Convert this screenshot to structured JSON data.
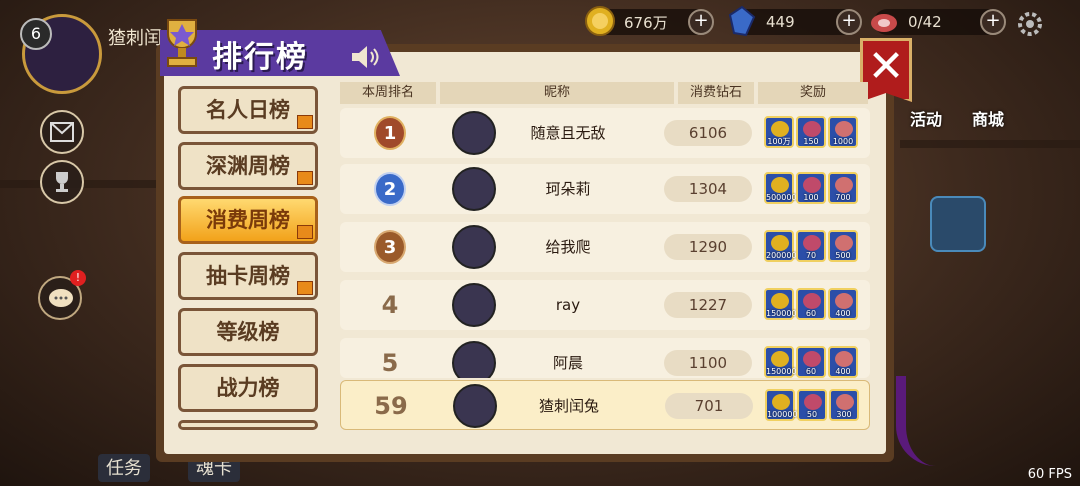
{
  "hud": {
    "level": "6",
    "player_name": "猹刺闰兔",
    "coins": "676万",
    "crystals": "449",
    "meat": "0/42",
    "fps": "60 FPS"
  },
  "title": "排行榜",
  "tabs": [
    {
      "label": "名人日榜",
      "active": false,
      "gift": true
    },
    {
      "label": "深渊周榜",
      "active": false,
      "gift": true
    },
    {
      "label": "消费周榜",
      "active": true,
      "gift": true
    },
    {
      "label": "抽卡周榜",
      "active": false,
      "gift": true
    },
    {
      "label": "等级榜",
      "active": false,
      "gift": false
    },
    {
      "label": "战力榜",
      "active": false,
      "gift": false
    }
  ],
  "columns": [
    "本周排名",
    "昵称",
    "消费钻石",
    "奖励"
  ],
  "rows": [
    {
      "rank": "1",
      "name": "随意且无敌",
      "cost": "6106",
      "rewards": [
        "100万",
        "150",
        "1000"
      ]
    },
    {
      "rank": "2",
      "name": "珂朵莉",
      "cost": "1304",
      "rewards": [
        "500000",
        "100",
        "700"
      ]
    },
    {
      "rank": "3",
      "name": "给我爬",
      "cost": "1290",
      "rewards": [
        "200000",
        "70",
        "500"
      ]
    },
    {
      "rank": "4",
      "name": "ray",
      "cost": "1227",
      "rewards": [
        "150000",
        "60",
        "400"
      ]
    },
    {
      "rank": "5",
      "name": "阿晨",
      "cost": "1100",
      "rewards": [
        "150000",
        "60",
        "400"
      ]
    }
  ],
  "my_row": {
    "rank": "59",
    "name": "猹刺闰兔",
    "cost": "701",
    "rewards": [
      "100000",
      "50",
      "300"
    ]
  },
  "side_labels": {
    "activity": "活动",
    "shop": "商城",
    "task": "任务",
    "soul": "魂卡"
  }
}
